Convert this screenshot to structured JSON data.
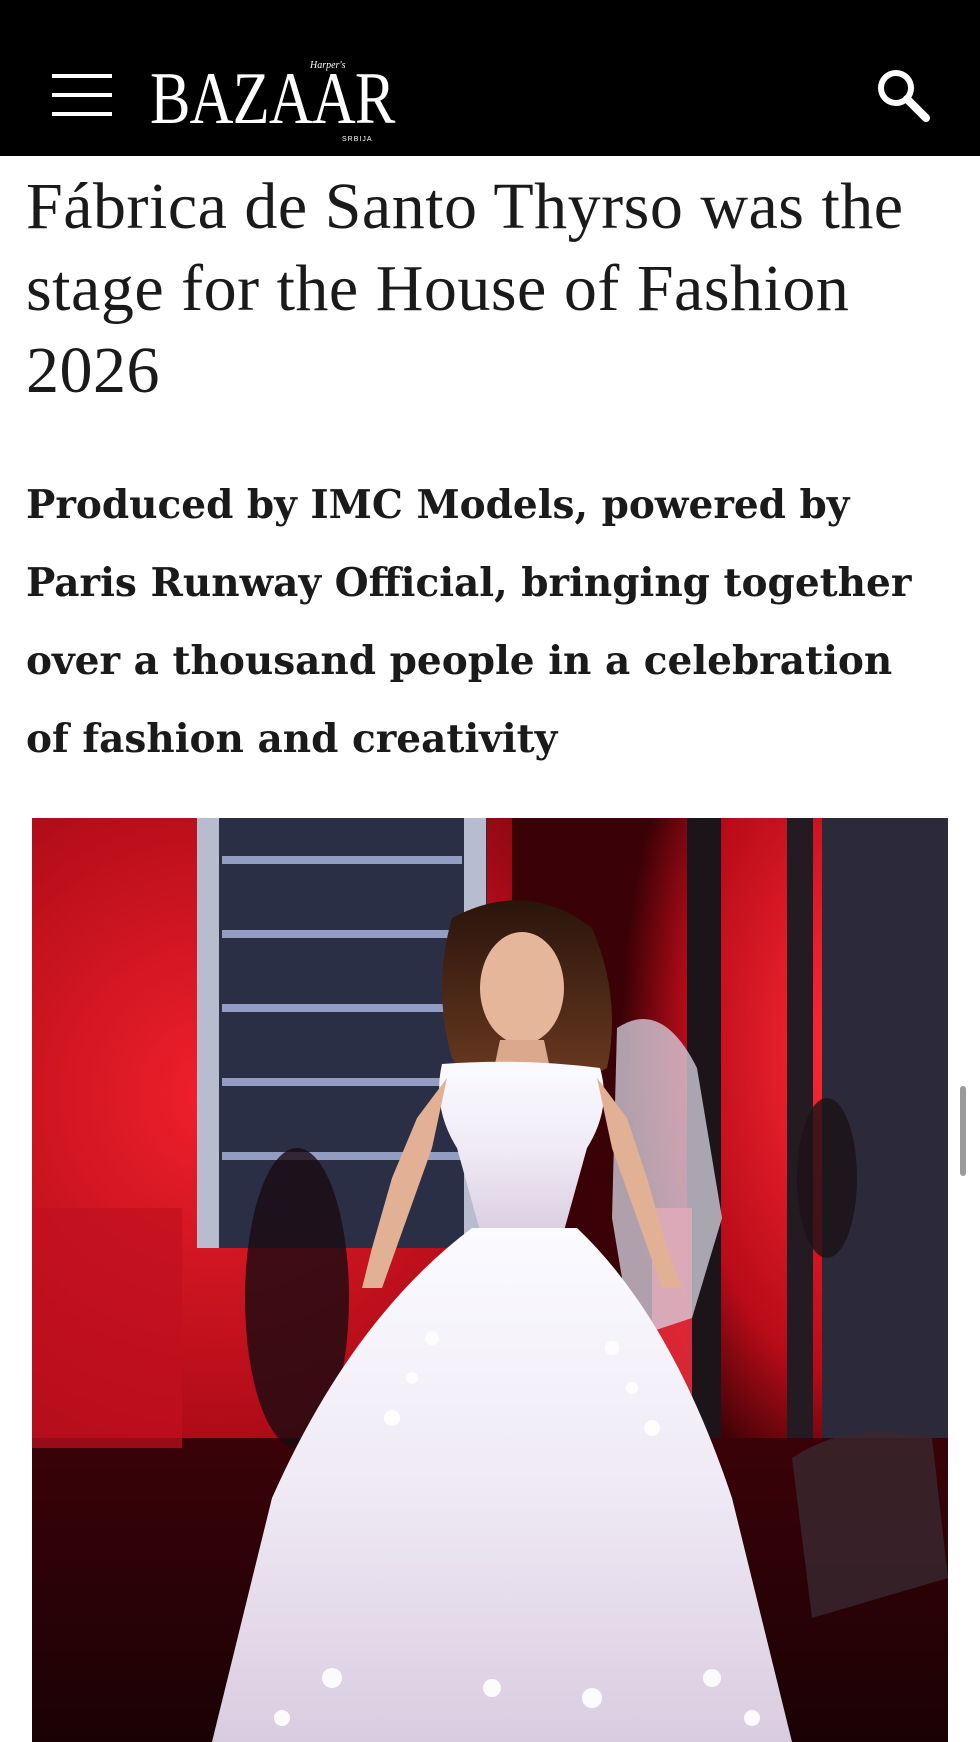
{
  "header": {
    "logo_text": "BAZAAR",
    "logo_small": "Harper's",
    "logo_region": "SRBIJA",
    "menu_icon": "hamburger-menu-icon",
    "search_icon": "search-icon",
    "background_color": "#000000"
  },
  "article": {
    "title": "Fábrica de Santo Thyrso was the stage for the House of Fashion 2026",
    "subtitle": "Produced by IMC Models, powered by Paris Runway Official, bringing together over a thousand people in a celebration of fashion and creativity",
    "image": {
      "type": "photo",
      "accent_color": "#d0101e"
    }
  }
}
